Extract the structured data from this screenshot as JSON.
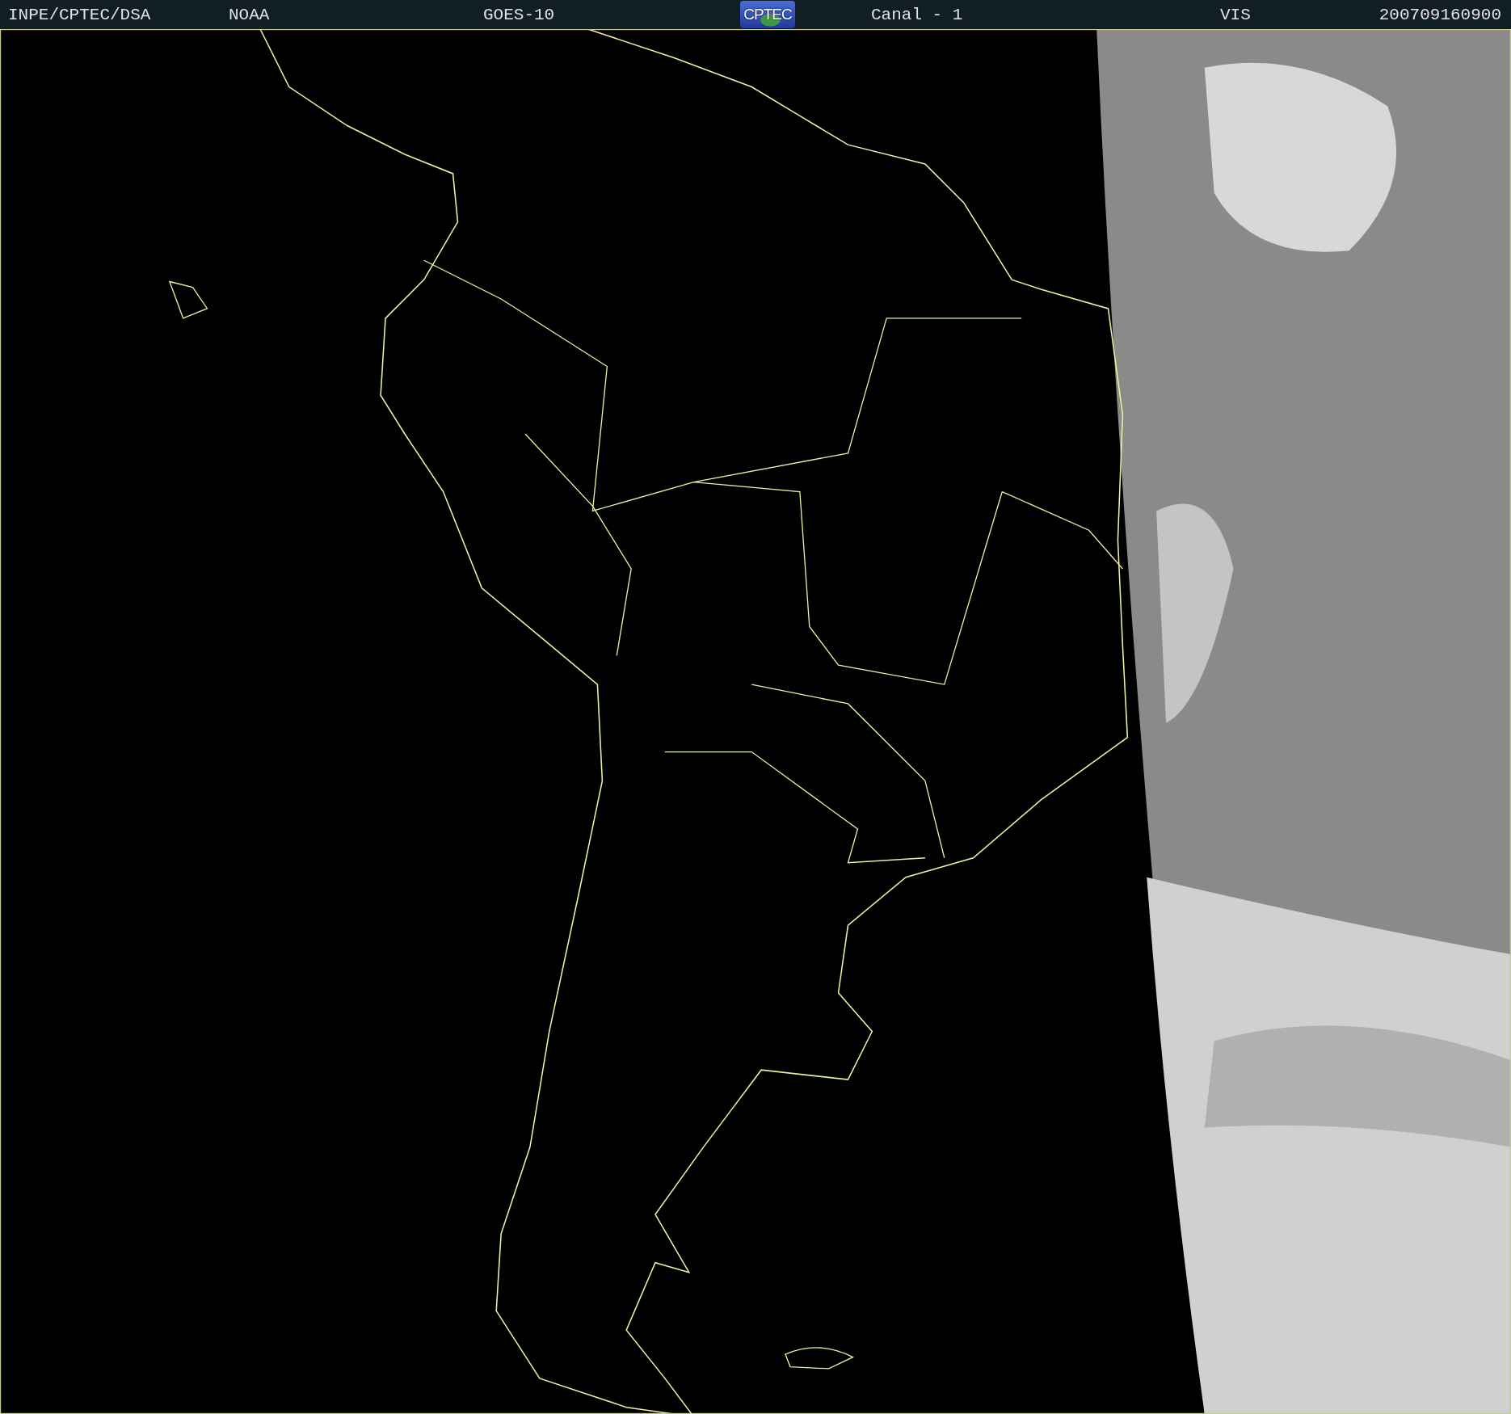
{
  "header": {
    "items": [
      {
        "kind": "text",
        "text": "INPE/CPTEC/DSA"
      },
      {
        "kind": "text",
        "text": "NOAA"
      },
      {
        "kind": "text",
        "text": "GOES-10"
      },
      {
        "kind": "logo",
        "text": "CPTEC"
      },
      {
        "kind": "text",
        "text": "Canal - 1"
      },
      {
        "kind": "text",
        "text": "VIS"
      },
      {
        "kind": "text",
        "text": "200709160900"
      }
    ]
  }
}
